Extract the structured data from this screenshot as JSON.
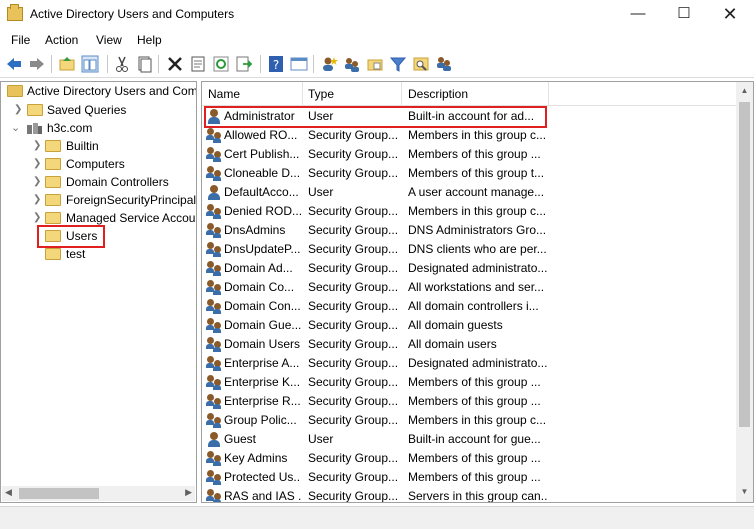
{
  "window": {
    "title": "Active Directory Users and Computers"
  },
  "menu": [
    "File",
    "Action",
    "View",
    "Help"
  ],
  "tree": {
    "root": "Active Directory Users and Com",
    "items": [
      {
        "label": "Saved Queries",
        "level": 1
      },
      {
        "label": "h3c.com",
        "level": 1
      },
      {
        "label": "Builtin",
        "level": 2
      },
      {
        "label": "Computers",
        "level": 2
      },
      {
        "label": "Domain Controllers",
        "level": 2
      },
      {
        "label": "ForeignSecurityPrincipals",
        "level": 2
      },
      {
        "label": "Managed Service Accour",
        "level": 2
      },
      {
        "label": "Users",
        "level": 2
      },
      {
        "label": "test",
        "level": 2
      }
    ]
  },
  "list": {
    "columns": [
      "Name",
      "Type",
      "Description"
    ],
    "rows": [
      {
        "icon": "user-icon",
        "name": "Administrator",
        "type": "User",
        "desc": "Built-in account for ad..."
      },
      {
        "icon": "group-icon",
        "name": "Allowed RO...",
        "type": "Security Group...",
        "desc": "Members in this group c..."
      },
      {
        "icon": "group-icon",
        "name": "Cert Publish...",
        "type": "Security Group...",
        "desc": "Members of this group ..."
      },
      {
        "icon": "group-icon",
        "name": "Cloneable D...",
        "type": "Security Group...",
        "desc": "Members of this group t..."
      },
      {
        "icon": "user-icon",
        "name": "DefaultAcco...",
        "type": "User",
        "desc": "A user account manage..."
      },
      {
        "icon": "group-icon",
        "name": "Denied ROD...",
        "type": "Security Group...",
        "desc": "Members in this group c..."
      },
      {
        "icon": "group-icon",
        "name": "DnsAdmins",
        "type": "Security Group...",
        "desc": "DNS Administrators Gro..."
      },
      {
        "icon": "group-icon",
        "name": "DnsUpdateP...",
        "type": "Security Group...",
        "desc": "DNS clients who are per..."
      },
      {
        "icon": "group-icon",
        "name": "Domain Ad...",
        "type": "Security Group...",
        "desc": "Designated administrato..."
      },
      {
        "icon": "group-icon",
        "name": "Domain Co...",
        "type": "Security Group...",
        "desc": "All workstations and ser..."
      },
      {
        "icon": "group-icon",
        "name": "Domain Con...",
        "type": "Security Group...",
        "desc": "All domain controllers i..."
      },
      {
        "icon": "group-icon",
        "name": "Domain Gue...",
        "type": "Security Group...",
        "desc": "All domain guests"
      },
      {
        "icon": "group-icon",
        "name": "Domain Users",
        "type": "Security Group...",
        "desc": "All domain users"
      },
      {
        "icon": "group-icon",
        "name": "Enterprise A...",
        "type": "Security Group...",
        "desc": "Designated administrato..."
      },
      {
        "icon": "group-icon",
        "name": "Enterprise K...",
        "type": "Security Group...",
        "desc": "Members of this group ..."
      },
      {
        "icon": "group-icon",
        "name": "Enterprise R...",
        "type": "Security Group...",
        "desc": "Members of this group ..."
      },
      {
        "icon": "group-icon",
        "name": "Group Polic...",
        "type": "Security Group...",
        "desc": "Members in this group c..."
      },
      {
        "icon": "user-icon",
        "name": "Guest",
        "type": "User",
        "desc": "Built-in account for gue..."
      },
      {
        "icon": "group-icon",
        "name": "Key Admins",
        "type": "Security Group...",
        "desc": "Members of this group ..."
      },
      {
        "icon": "group-icon",
        "name": "Protected Us...",
        "type": "Security Group...",
        "desc": "Members of this group ..."
      },
      {
        "icon": "group-icon",
        "name": "RAS and IAS ...",
        "type": "Security Group...",
        "desc": "Servers in this group can..."
      }
    ]
  },
  "colors": {
    "highlight": "#e02020",
    "folder": "#f3d77a",
    "toolbar_blue": "#2f6fc2"
  }
}
